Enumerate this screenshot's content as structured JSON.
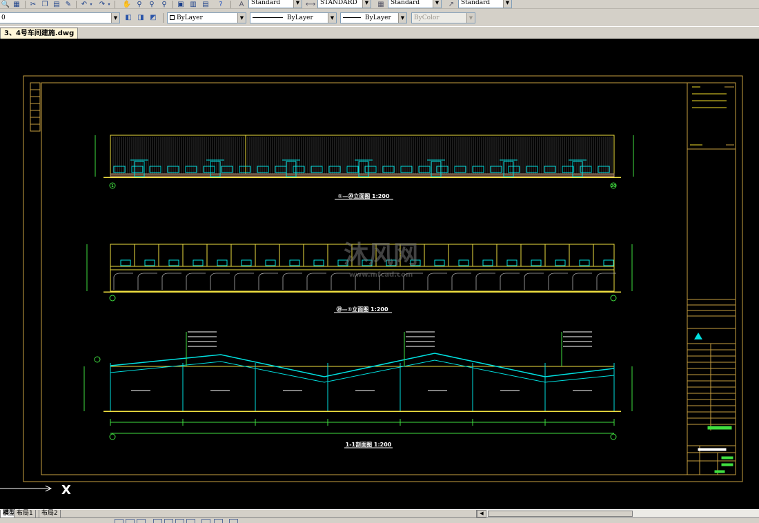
{
  "toolbar": {
    "standard_icons": [
      "zoom-icon",
      "print-icon",
      "cut-icon",
      "copy-icon",
      "paste-icon",
      "match-properties-icon",
      "undo-icon",
      "redo-icon",
      "pan-icon",
      "zoom-realtime-icon",
      "zoom-window-icon",
      "zoom-previous-icon",
      "properties-icon",
      "design-center-icon",
      "tool-palettes-icon",
      "help-icon"
    ],
    "text_style": "Standard",
    "dim_style": "STANDARD",
    "table_style": "Standard",
    "multileader_style": "Standard"
  },
  "layers_bar": {
    "layer_value": "0",
    "color_value": "ByLayer",
    "linetype_value": "ByLayer",
    "lineweight_value": "ByLayer",
    "plotstyle_value": "ByColor"
  },
  "document": {
    "tab_title": "3、4号车间建施.dwg"
  },
  "drawing": {
    "view1_title": "①—⑳立面图 1:200",
    "view2_title": "⑳—①立面图 1:200",
    "view3_title": "1-1剖面图 1:200",
    "watermark": "沐风网",
    "watermark_url": "www.mfcad.com",
    "axis_start": "1",
    "axis_end": "20",
    "ucs_label": "X"
  },
  "layout_tabs": {
    "model": "模型",
    "layout1": "布局1",
    "layout2": "布局2"
  },
  "colors": {
    "background": "#000000",
    "frame": "#c8a040",
    "elevation_yellow": "#f0e040",
    "elevation_cyan": "#00e0e0",
    "dimension_green": "#40e040",
    "title_yellow": "#f5e12a",
    "section_roof": "#00e0e0"
  }
}
